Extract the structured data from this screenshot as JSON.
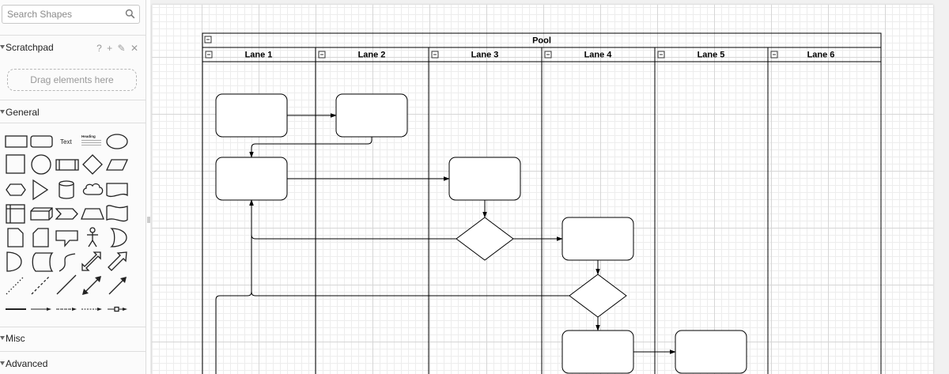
{
  "sidebar": {
    "search_placeholder": "Search Shapes",
    "scratchpad": {
      "label": "Scratchpad",
      "actions": [
        "?",
        "+",
        "✎",
        "✕"
      ],
      "drop_hint": "Drag elements here"
    },
    "general": {
      "label": "General",
      "text_shape_label": "Text",
      "heading_shape_label": "Heading"
    },
    "misc": {
      "label": "Misc"
    },
    "advanced": {
      "label": "Advanced"
    }
  },
  "diagram": {
    "pool_title": "Pool",
    "lanes": [
      "Lane 1",
      "Lane 2",
      "Lane 3",
      "Lane 4",
      "Lane 5",
      "Lane 6"
    ]
  },
  "icons": {
    "search": "search-icon",
    "collapse": "collapse-icon",
    "section_toggle": "triangle-down-icon"
  }
}
